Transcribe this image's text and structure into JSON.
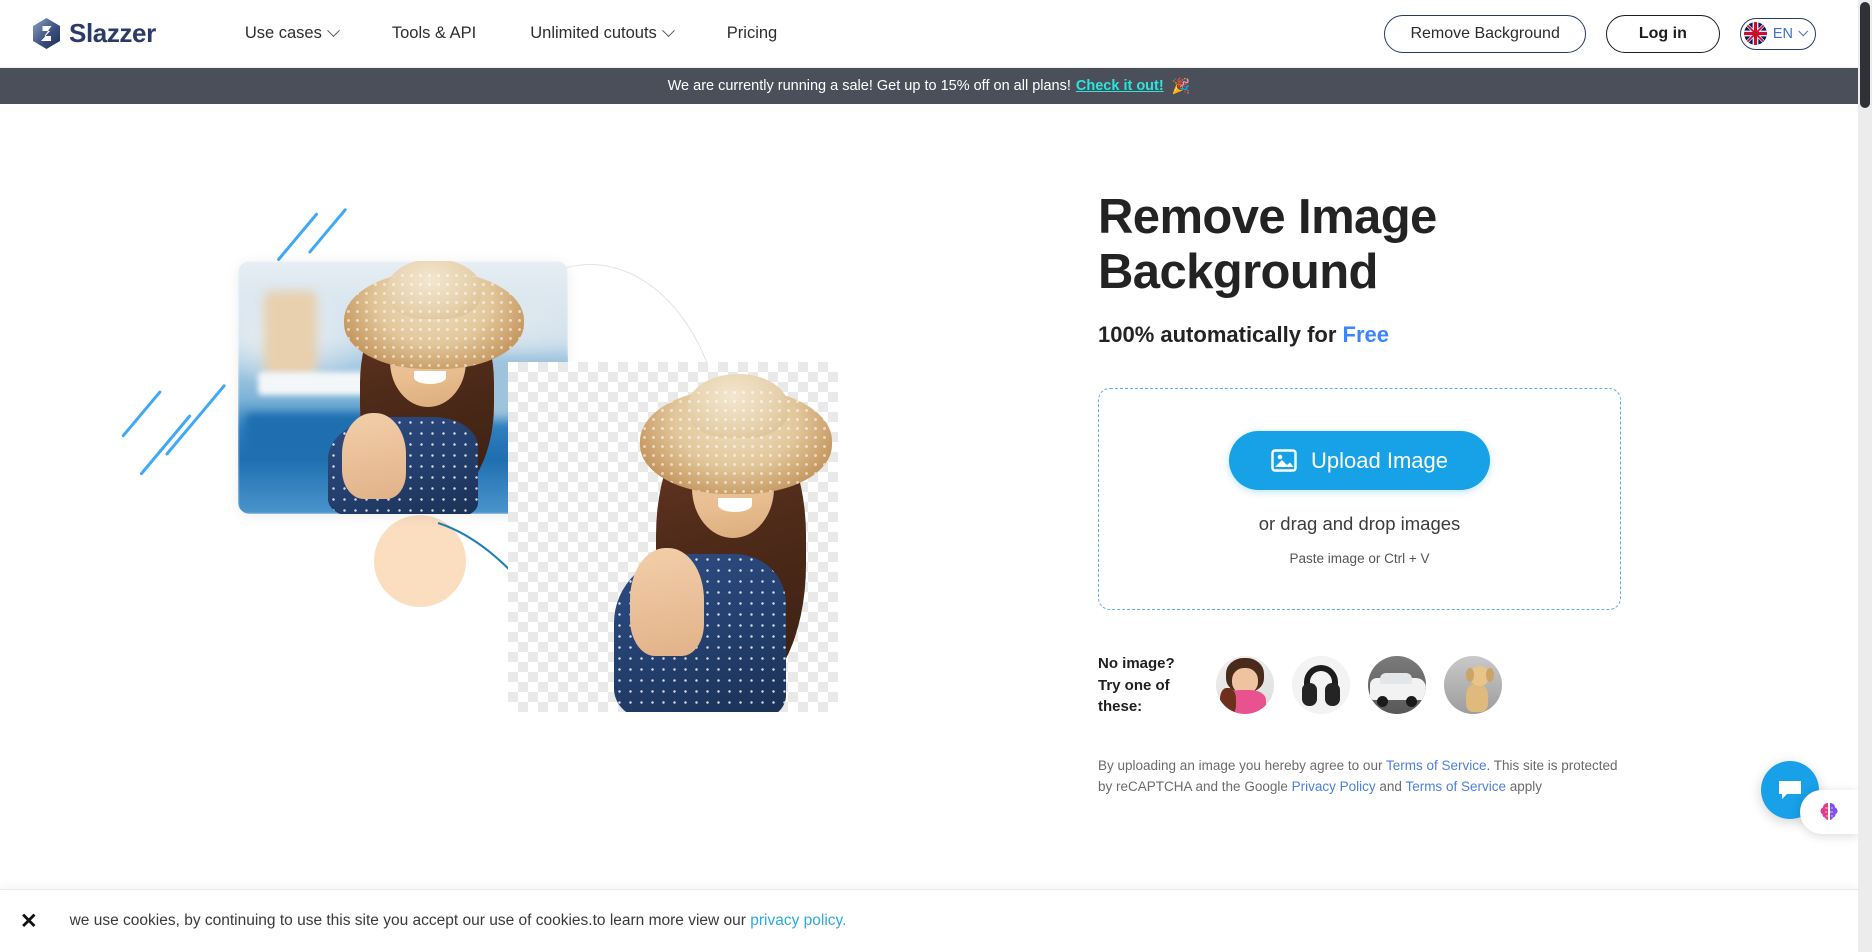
{
  "brand": {
    "name": "Slazzer",
    "logo_icon": "slazzer-logo-icon"
  },
  "nav": {
    "items": [
      {
        "label": "Use cases",
        "has_dropdown": true
      },
      {
        "label": "Tools & API",
        "has_dropdown": false
      },
      {
        "label": "Unlimited cutouts",
        "has_dropdown": true
      },
      {
        "label": "Pricing",
        "has_dropdown": false
      }
    ]
  },
  "header_actions": {
    "remove_background_label": "Remove Background",
    "login_label": "Log in",
    "language": {
      "code": "EN",
      "flag_icon": "uk-flag-icon",
      "chevron_icon": "chevron-down-icon"
    }
  },
  "sale_banner": {
    "text": "We are currently running a sale! Get up to 15% off on all plans!",
    "link_label": "Check it out!",
    "emoji": "🎉",
    "background": "#4a4f5a",
    "link_color": "#2fe3dd"
  },
  "hero": {
    "title_line1": "Remove Image",
    "title_line2": "Background",
    "subtitle_prefix": "100% automatically for ",
    "subtitle_highlight": "Free",
    "highlight_color": "#3a86ff"
  },
  "upload": {
    "button_label": "Upload Image",
    "button_icon": "image-icon",
    "button_color": "#17a2e8",
    "drag_text": "or drag and drop images",
    "paste_text": "Paste image or Ctrl + V",
    "border_color": "#6aa7ef"
  },
  "samples": {
    "label_line1": "No image?",
    "label_line2": "Try one of these:",
    "items": [
      {
        "name": "sample-woman-pink"
      },
      {
        "name": "sample-headphones"
      },
      {
        "name": "sample-white-car"
      },
      {
        "name": "sample-dog"
      }
    ]
  },
  "legal": {
    "part1": "By uploading an image you hereby agree to our ",
    "terms1": "Terms of Service",
    "part2": ". This site is protected by reCAPTCHA and the Google ",
    "privacy": "Privacy Policy",
    "part3": " and ",
    "terms2": "Terms of Service",
    "part4": " apply"
  },
  "cookie_bar": {
    "close_icon": "close-icon",
    "text": "we use cookies, by continuing to use this site you accept our use of cookies.to learn more view our ",
    "link_label": "privacy policy.",
    "link_color": "#2eaae0"
  },
  "chat": {
    "fab_icon": "chat-bubble-icon",
    "fab_color": "#18a0e8",
    "ai_icon": "brain-icon"
  },
  "illustration": {
    "original_photo_alt": "woman-in-straw-hat-original",
    "cutout_photo_alt": "woman-in-straw-hat-cutout",
    "arrow_icon": "curved-arrow-icon",
    "accent_line_color": "#3fa9f5",
    "accent_circle_color": "#fbdec0"
  },
  "scrollbar": {
    "name": "page-scrollbar"
  }
}
